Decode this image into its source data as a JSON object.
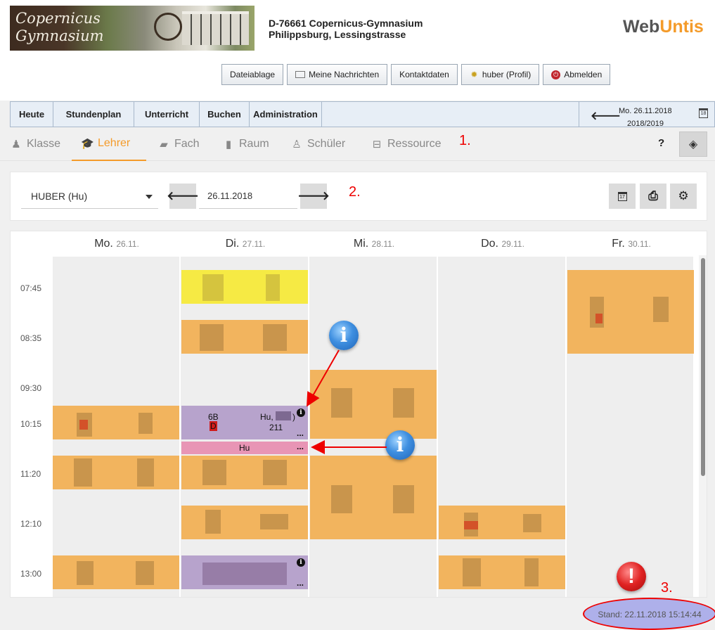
{
  "header": {
    "school_line1": "D-76661 Copernicus-Gymnasium",
    "school_line2": "Philippsburg, Lessingstrasse",
    "logo_text": "Copernicus Gymnasium",
    "brand_part1": "Web",
    "brand_part2": "Untis",
    "buttons": {
      "files": "Dateiablage",
      "messages": "Meine Nachrichten",
      "contact": "Kontaktdaten",
      "profile": "huber (Profil)",
      "logout": "Abmelden"
    }
  },
  "nav": {
    "items": [
      "Heute",
      "Stundenplan",
      "Unterricht",
      "Buchen",
      "Administration"
    ],
    "date": "Mo. 26.11.2018",
    "school_year": "2018/2019",
    "calendar_day": "18"
  },
  "element_tabs": {
    "items": [
      "Klasse",
      "Lehrer",
      "Fach",
      "Raum",
      "Schüler",
      "Ressource"
    ],
    "active": "Lehrer",
    "help": "?"
  },
  "annotations": {
    "a1": "1.",
    "a2": "2.",
    "a3": "3."
  },
  "toolbar": {
    "teacher": "HUBER (Hu)",
    "date": "26.11.2018",
    "calendar_day": "17"
  },
  "timetable": {
    "days": [
      {
        "name": "Mo.",
        "date": "26.11."
      },
      {
        "name": "Di.",
        "date": "27.11."
      },
      {
        "name": "Mi.",
        "date": "28.11."
      },
      {
        "name": "Do.",
        "date": "29.11."
      },
      {
        "name": "Fr.",
        "date": "30.11."
      }
    ],
    "times": [
      "07:45",
      "08:35",
      "09:30",
      "10:15",
      "11:20",
      "12:10",
      "13:00"
    ],
    "tue_lesson": {
      "class": "6B",
      "teacher": "Hu,",
      "teacher_suffix": ")",
      "room": "211",
      "subject_marker": "D",
      "more": "..."
    },
    "tue_event": {
      "label": "Hu",
      "more": "..."
    },
    "tue_last_more": "..."
  },
  "status": {
    "stand": "Stand: 22.11.2018 15:14:44"
  },
  "colors": {
    "accent": "#f49b2a",
    "lesson": "#f2b45e",
    "lesson_yellow": "#f6ea44",
    "lesson_purple": "#b7a3cc",
    "event_pink": "#e895b5",
    "annotation": "#ee0000"
  },
  "icons": {
    "tab_klasse": "people-icon",
    "tab_lehrer": "graduation-cap-icon",
    "tab_fach": "book-icon",
    "tab_raum": "door-icon",
    "tab_schueler": "student-icon",
    "tab_ressource": "projector-icon"
  }
}
